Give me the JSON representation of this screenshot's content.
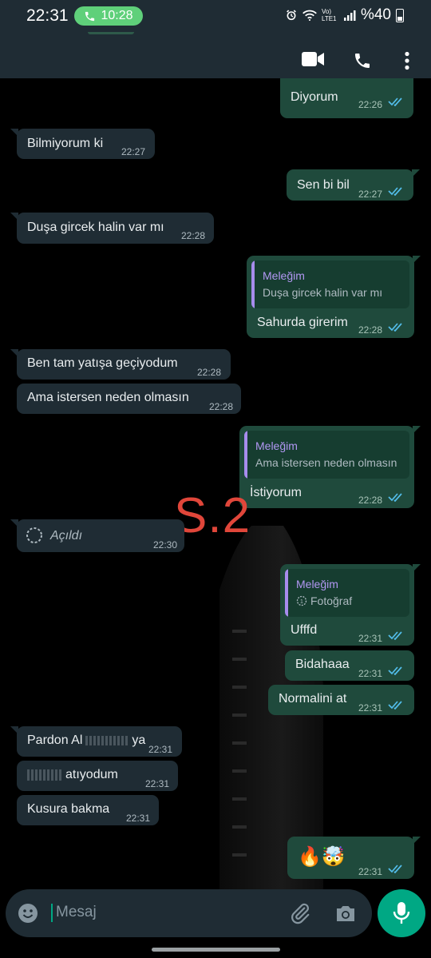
{
  "status_bar": {
    "time": "22:31",
    "call_duration": "10:28",
    "network": "Vo) LTE1",
    "battery": "%40"
  },
  "messages": {
    "m1": {
      "text": "Diyorum",
      "time": "22:26"
    },
    "m2": {
      "text": "Bilmiyorum ki",
      "time": "22:27"
    },
    "m3": {
      "text": "Sen bi bil",
      "time": "22:27"
    },
    "m4": {
      "text": "Duşa gircek halin var mı",
      "time": "22:28"
    },
    "m5": {
      "quote_name": "Meleğim",
      "quote_text": "Duşa gircek halin var mı",
      "text": "Sahurda girerim",
      "time": "22:28"
    },
    "m6": {
      "text": "Ben tam yatışa geçiyodum",
      "time": "22:28"
    },
    "m7": {
      "text": "Ama istersen neden olmasın",
      "time": "22:28"
    },
    "m8": {
      "quote_name": "Meleğim",
      "quote_text": "Ama istersen neden olmasın",
      "text": "İstiyorum",
      "time": "22:28"
    },
    "m9": {
      "text": "Açıldı",
      "time": "22:30"
    },
    "m10": {
      "quote_name": "Meleğim",
      "quote_text": "Fotoğraf",
      "text": "Ufffd",
      "time": "22:31"
    },
    "m11": {
      "text": "Bidahaaa",
      "time": "22:31"
    },
    "m12": {
      "text": "Normalini at",
      "time": "22:31"
    },
    "m13": {
      "text_a": "Pardon Al",
      "text_b": "ya",
      "time": "22:31"
    },
    "m14": {
      "text": "atıyodum",
      "time": "22:31"
    },
    "m15": {
      "text": "Kusura bakma",
      "time": "22:31"
    },
    "m16": {
      "text": "🔥🤯",
      "time": "22:31"
    }
  },
  "watermark": "S.2",
  "composer": {
    "placeholder": "Mesaj"
  },
  "colors": {
    "accent": "#00a884",
    "incoming": "#1f2c34",
    "outgoing": "#1f4a3c",
    "quote_name": "#b197f2",
    "read_ticks": "#53bdeb",
    "watermark": "#e0463a"
  }
}
